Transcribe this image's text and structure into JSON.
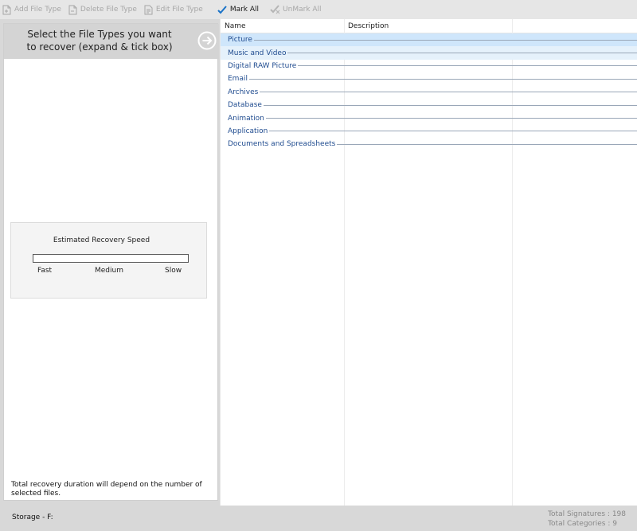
{
  "toolbar": {
    "add_file_type": "Add File Type",
    "delete_file_type": "Delete File Type",
    "edit_file_type": "Edit File Type",
    "mark_all": "Mark All",
    "unmark_all": "UnMark All"
  },
  "left_panel": {
    "header_line1": "Select the File Types you want",
    "header_line2": "to recover (expand & tick box)",
    "speed": {
      "title": "Estimated Recovery Speed",
      "fast": "Fast",
      "medium": "Medium",
      "slow": "Slow",
      "level": 0
    },
    "note": "Total recovery duration will depend on the number of selected files."
  },
  "list": {
    "columns": [
      "Name",
      "Description"
    ],
    "rows": [
      {
        "name": "Picture",
        "state": "selected"
      },
      {
        "name": "Music and Video",
        "state": "hover"
      },
      {
        "name": "Digital RAW Picture",
        "state": ""
      },
      {
        "name": "Email",
        "state": ""
      },
      {
        "name": "Archives",
        "state": ""
      },
      {
        "name": "Database",
        "state": ""
      },
      {
        "name": "Animation",
        "state": ""
      },
      {
        "name": "Application",
        "state": ""
      },
      {
        "name": "Documents and Spreadsheets",
        "state": ""
      }
    ]
  },
  "status": {
    "storage": "Storage - F:",
    "total_signatures": "Total Signatures : 198",
    "total_categories": "Total Categories : 9"
  },
  "colors": {
    "accent_check": "#1a73c8",
    "row_selected": "#cfe6fb",
    "row_hover": "#e5f1fb",
    "row_text": "#1f4b8f"
  }
}
